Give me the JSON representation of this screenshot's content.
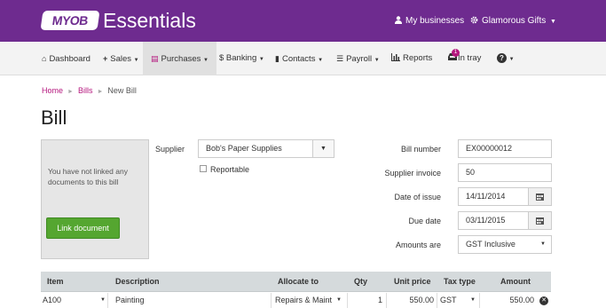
{
  "brand": {
    "logo": "MYOB",
    "name": "Essentials"
  },
  "topbar": {
    "my_businesses": "My businesses",
    "company": "Glamorous Gifts"
  },
  "nav": {
    "dashboard": "Dashboard",
    "sales": "Sales",
    "purchases": "Purchases",
    "banking": "$ Banking",
    "contacts": "Contacts",
    "payroll": "Payroll",
    "reports": "Reports",
    "in_tray": "In tray",
    "in_tray_count": "1"
  },
  "breadcrumb": {
    "home": "Home",
    "bills": "Bills",
    "current": "New Bill"
  },
  "page_title": "Bill",
  "doc_panel": {
    "message": "You have not linked any documents to this bill",
    "link_button": "Link document"
  },
  "form": {
    "supplier_label": "Supplier",
    "supplier_value": "Bob's Paper Supplies",
    "reportable_label": "Reportable",
    "bill_number_label": "Bill number",
    "bill_number": "EX00000012",
    "supplier_invoice_label": "Supplier invoice",
    "supplier_invoice": "50",
    "date_of_issue_label": "Date of issue",
    "date_of_issue": "14/11/2014",
    "due_date_label": "Due date",
    "due_date": "03/11/2015",
    "amounts_are_label": "Amounts are",
    "amounts_are": "GST Inclusive"
  },
  "table": {
    "headers": {
      "item": "Item",
      "description": "Description",
      "allocate_to": "Allocate to",
      "qty": "Qty",
      "unit_price": "Unit price",
      "tax_type": "Tax type",
      "amount": "Amount"
    },
    "rows": [
      {
        "item": "A100",
        "description": "Painting",
        "allocate_to": "Repairs & Maint",
        "qty": "1",
        "unit_price": "550.00",
        "tax_type": "GST",
        "amount": "550.00"
      }
    ]
  },
  "colors": {
    "brand_purple": "#6e2b8f",
    "link_pink": "#b5177e",
    "green_button": "#55a630"
  }
}
